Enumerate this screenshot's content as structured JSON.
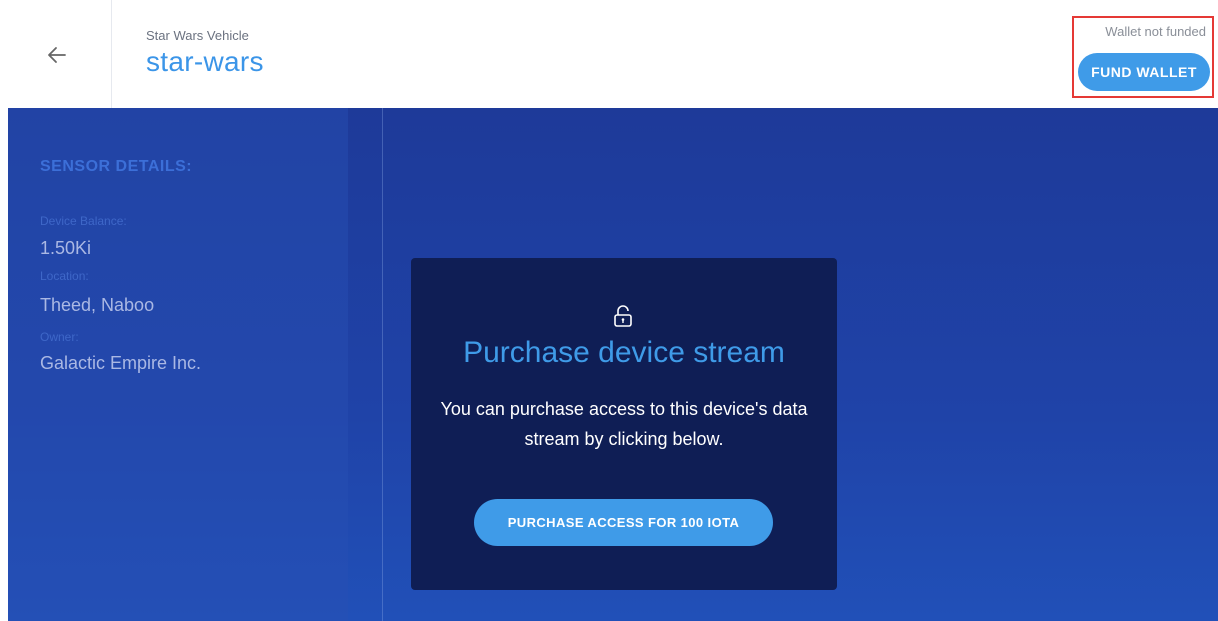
{
  "header": {
    "back_icon": "arrow-left-icon",
    "subtitle": "Star Wars Vehicle",
    "title": "star-wars"
  },
  "wallet": {
    "status": "Wallet not funded",
    "button_label": "FUND WALLET"
  },
  "sidebar": {
    "heading": "SENSOR DETAILS:",
    "fields": [
      {
        "label": "Device Balance:",
        "value": "1.50Ki"
      },
      {
        "label": "Location:",
        "value": "Theed, Naboo"
      },
      {
        "label": "Owner:",
        "value": "Galactic Empire Inc."
      }
    ]
  },
  "card": {
    "icon": "lock-icon",
    "heading": "Purchase device stream",
    "text": "You can purchase access to this device's data stream by clicking below.",
    "button_label": "PURCHASE ACCESS FOR 100 IOTA"
  },
  "colors": {
    "accent": "#3f9be8",
    "highlight_border": "#e53935",
    "card_bg": "#0f1e55"
  }
}
